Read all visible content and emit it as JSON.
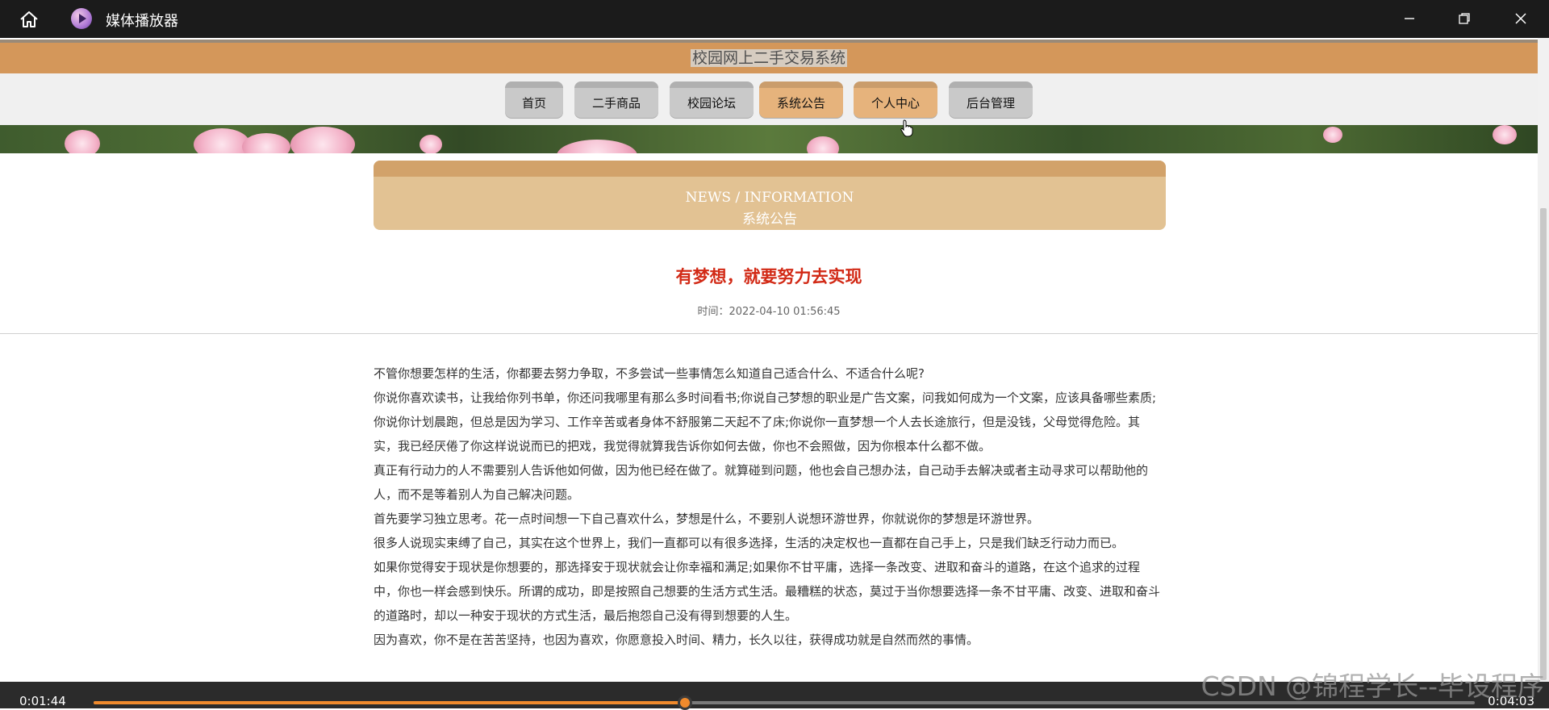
{
  "window": {
    "title": "媒体播放器",
    "icons": {
      "home": "home-icon",
      "app": "media-player-icon",
      "minimize": "minimize-icon",
      "restore": "restore-icon",
      "close": "close-icon"
    }
  },
  "site": {
    "title": "校园网上二手交易系统",
    "nav": [
      {
        "label": "首页",
        "active": false
      },
      {
        "label": "二手商品",
        "active": false
      },
      {
        "label": "校园论坛",
        "active": false
      },
      {
        "label": "系统公告",
        "active": true
      },
      {
        "label": "个人中心",
        "active": true
      },
      {
        "label": "后台管理",
        "active": false
      }
    ]
  },
  "section": {
    "en": "NEWS / INFORMATION",
    "cn": "系统公告"
  },
  "article": {
    "title": "有梦想，就要努力去实现",
    "time_label": "时间：",
    "time_value": "2022-04-10 01:56:45",
    "paragraphs": [
      "不管你想要怎样的生活，你都要去努力争取，不多尝试一些事情怎么知道自己适合什么、不适合什么呢?",
      "你说你喜欢读书，让我给你列书单，你还问我哪里有那么多时间看书;你说自己梦想的职业是广告文案，问我如何成为一个文案，应该具备哪些素质;你说你计划晨跑，但总是因为学习、工作辛苦或者身体不舒服第二天起不了床;你说你一直梦想一个人去长途旅行，但是没钱，父母觉得危险。其实，我已经厌倦了你这样说说而已的把戏，我觉得就算我告诉你如何去做，你也不会照做，因为你根本什么都不做。",
      "真正有行动力的人不需要别人告诉他如何做，因为他已经在做了。就算碰到问题，他也会自己想办法，自己动手去解决或者主动寻求可以帮助他的人，而不是等着别人为自己解决问题。",
      "首先要学习独立思考。花一点时间想一下自己喜欢什么，梦想是什么，不要别人说想环游世界，你就说你的梦想是环游世界。",
      "很多人说现实束缚了自己，其实在这个世界上，我们一直都可以有很多选择，生活的决定权也一直都在自己手上，只是我们缺乏行动力而已。",
      "如果你觉得安于现状是你想要的，那选择安于现状就会让你幸福和满足;如果你不甘平庸，选择一条改变、进取和奋斗的道路，在这个追求的过程中，你也一样会感到快乐。所谓的成功，即是按照自己想要的生活方式生活。最糟糕的状态，莫过于当你想要选择一条不甘平庸、改变、进取和奋斗的道路时，却以一种安于现状的方式生活，最后抱怨自己没有得到想要的人生。",
      "因为喜欢，你不是在苦苦坚持，也因为喜欢，你愿意投入时间、精力，长久以往，获得成功就是自然而然的事情。"
    ]
  },
  "player": {
    "current_time": "0:01:44",
    "total_time": "0:04:03",
    "progress": 0.428,
    "accent": "#f08a2c"
  },
  "watermark": "CSDN @锦程学长--毕设程序"
}
